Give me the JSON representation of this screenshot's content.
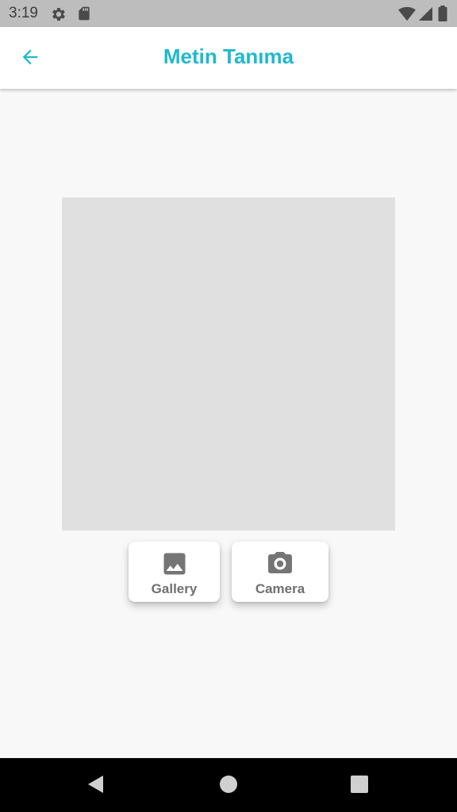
{
  "status_bar": {
    "time": "3:19",
    "left_icons": [
      "settings-icon",
      "sd-card-icon"
    ],
    "right_icons": [
      "wifi-icon",
      "signal-icon",
      "battery-icon"
    ]
  },
  "app_bar": {
    "title": "Metin Tanıma",
    "back_icon": "arrow-back-icon",
    "accent_color": "#1fb8cf"
  },
  "image_placeholder": {
    "color": "#e0e0e0"
  },
  "actions": {
    "gallery": {
      "label": "Gallery",
      "icon": "image-icon"
    },
    "camera": {
      "label": "Camera",
      "icon": "camera-icon"
    }
  },
  "nav_bar": {
    "buttons": [
      "back-triangle-icon",
      "home-circle-icon",
      "recents-square-icon"
    ]
  }
}
